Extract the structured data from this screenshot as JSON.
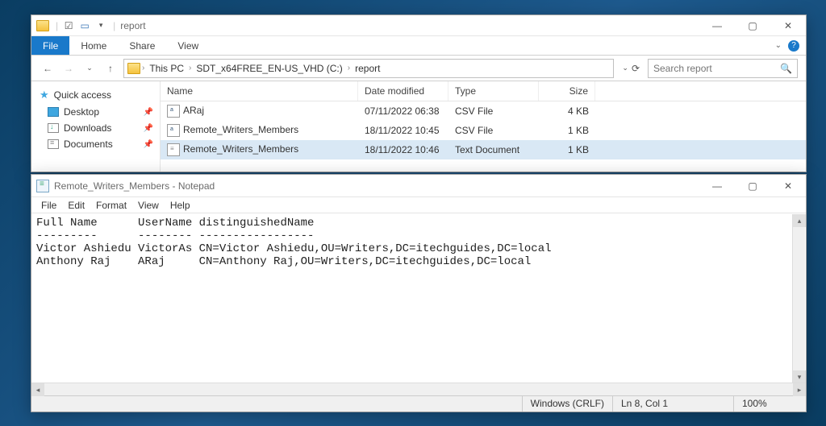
{
  "explorer": {
    "title": "report",
    "tabs": {
      "file": "File",
      "home": "Home",
      "share": "Share",
      "view": "View"
    },
    "breadcrumb": {
      "root": "This PC",
      "vol": "SDT_x64FREE_EN-US_VHD (C:)",
      "folder": "report"
    },
    "search_placeholder": "Search report",
    "nav": {
      "quick": "Quick access",
      "desktop": "Desktop",
      "downloads": "Downloads",
      "documents": "Documents"
    },
    "columns": {
      "name": "Name",
      "date": "Date modified",
      "type": "Type",
      "size": "Size"
    },
    "rows": [
      {
        "name": "ARaj",
        "date": "07/11/2022 06:38",
        "type": "CSV File",
        "size": "4 KB",
        "icon": "csv"
      },
      {
        "name": "Remote_Writers_Members",
        "date": "18/11/2022 10:45",
        "type": "CSV File",
        "size": "1 KB",
        "icon": "csv"
      },
      {
        "name": "Remote_Writers_Members",
        "date": "18/11/2022 10:46",
        "type": "Text Document",
        "size": "1 KB",
        "icon": "txt",
        "selected": true
      }
    ]
  },
  "notepad": {
    "title": "Remote_Writers_Members - Notepad",
    "menu": {
      "file": "File",
      "edit": "Edit",
      "format": "Format",
      "view": "View",
      "help": "Help"
    },
    "content": "Full Name      UserName distinguishedName\n---------      -------- -----------------\nVictor Ashiedu VictorAs CN=Victor Ashiedu,OU=Writers,DC=itechguides,DC=local\nAnthony Raj    ARaj     CN=Anthony Raj,OU=Writers,DC=itechguides,DC=local",
    "status": {
      "encoding": "Windows (CRLF)",
      "pos": "Ln 8, Col 1",
      "zoom": "100%"
    }
  }
}
